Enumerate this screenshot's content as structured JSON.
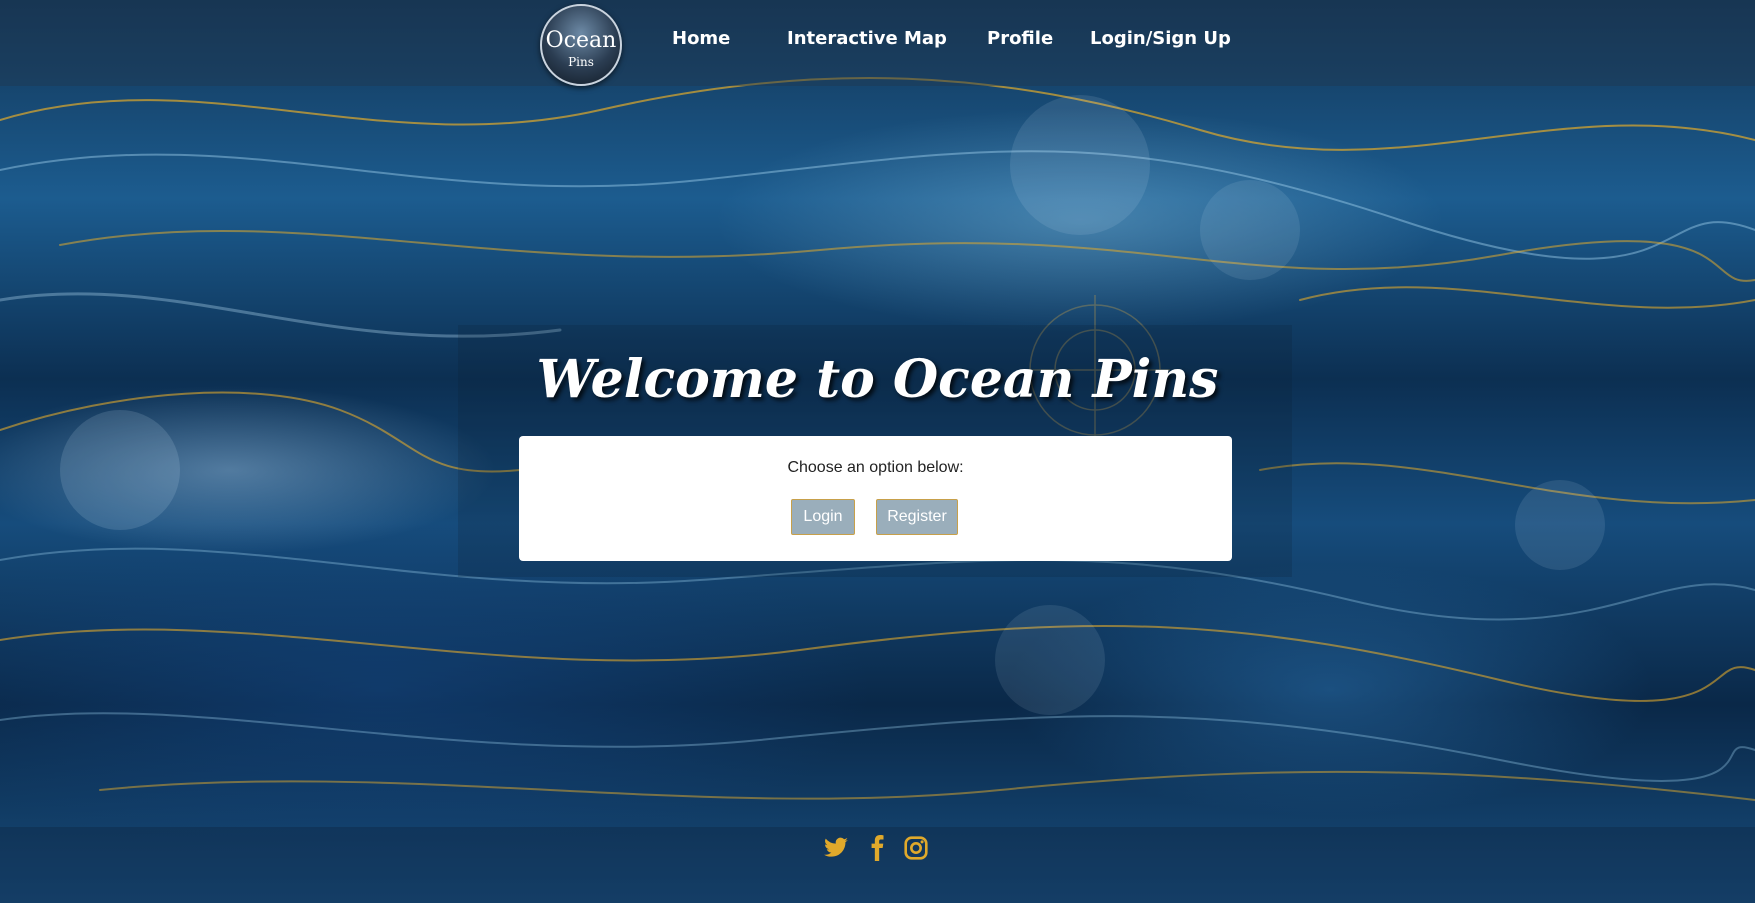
{
  "logo": {
    "line1": "Ocean",
    "line2": "Pins"
  },
  "nav": {
    "items": [
      {
        "label": "Home"
      },
      {
        "label": "Interactive Map"
      },
      {
        "label": "Profile"
      },
      {
        "label": "Login/Sign Up"
      }
    ]
  },
  "hero": {
    "title": "Welcome to Ocean Pins",
    "prompt": "Choose an option below:",
    "login_label": "Login",
    "register_label": "Register"
  },
  "footer": {
    "social": [
      {
        "icon": "twitter-icon"
      },
      {
        "icon": "facebook-icon"
      },
      {
        "icon": "instagram-icon"
      }
    ]
  },
  "colors": {
    "accent_gold": "#e0a92b",
    "button_bg": "#9aaebb",
    "button_border": "#c7a04a",
    "card_bg": "#ffffff"
  }
}
